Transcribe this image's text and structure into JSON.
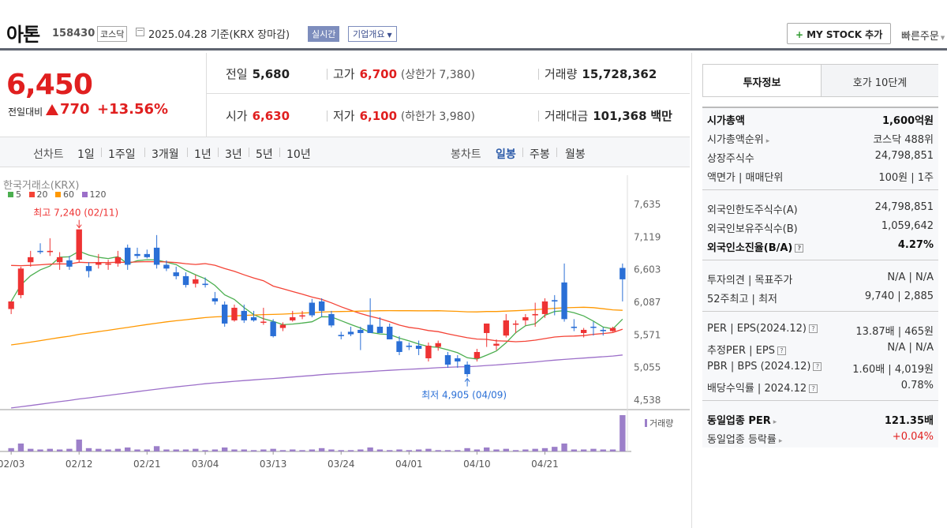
{
  "header": {
    "name": "아톤",
    "code": "158430",
    "market": "코스닥",
    "date": "2025.04.28  기준(KRX 장마감)",
    "realtime": "실시간",
    "overview": "기업개요",
    "my_stock": "MY STOCK 추가",
    "quick_order": "빠른주문"
  },
  "price": {
    "current": "6,450",
    "change_label": "전일대비",
    "change": "770",
    "change_pct": "+13.56%"
  },
  "stats": {
    "prev_label": "전일",
    "prev": "5,680",
    "high_label": "고가",
    "high": "6,700",
    "upper_limit": "(상한가 7,380)",
    "volume_label": "거래량",
    "volume": "15,728,362",
    "open_label": "시가",
    "open": "6,630",
    "low_label": "저가",
    "low": "6,100",
    "lower_limit": "(하한가 3,980)",
    "amount_label": "거래대금",
    "amount": "101,368",
    "amount_unit": "백만"
  },
  "toolbar": {
    "line_label": "선차트",
    "periods": [
      "1일",
      "1주일",
      "3개월",
      "1년",
      "3년",
      "5년",
      "10년"
    ],
    "candle_label": "봉차트",
    "candle_options": [
      "일봉",
      "주봉",
      "월봉"
    ]
  },
  "chart": {
    "source": "한국거래소(KRX)",
    "legend": [
      {
        "label": "5",
        "color": "#4caf50"
      },
      {
        "label": "20",
        "color": "#f44336"
      },
      {
        "label": "60",
        "color": "#ff9800"
      },
      {
        "label": "120",
        "color": "#9c6fc9"
      }
    ],
    "high_note": "최고 7,240 (02/11)",
    "low_note": "최저 4,905 (04/09)",
    "volume_label": "거래량"
  },
  "chart_data": {
    "type": "candlestick",
    "y_ticks": [
      "7,635",
      "7,119",
      "6,603",
      "6,087",
      "5,571",
      "5,055",
      "4,538"
    ],
    "ylim": [
      4538,
      7635
    ],
    "x_labels": [
      "02/03",
      "02/12",
      "02/21",
      "03/04",
      "03/13",
      "03/24",
      "04/01",
      "04/10",
      "04/21"
    ],
    "x_label_index": [
      0,
      7,
      14,
      20,
      27,
      34,
      41,
      48,
      55
    ],
    "candles": [
      {
        "o": 5980,
        "h": 6080,
        "l": 5900,
        "c": 6100
      },
      {
        "o": 6200,
        "h": 6650,
        "l": 6150,
        "c": 6620
      },
      {
        "o": 6720,
        "h": 6900,
        "l": 6650,
        "c": 6800
      },
      {
        "o": 6900,
        "h": 7020,
        "l": 6850,
        "c": 6880
      },
      {
        "o": 6880,
        "h": 7100,
        "l": 6820,
        "c": 6900
      },
      {
        "o": 6720,
        "h": 6880,
        "l": 6600,
        "c": 6800
      },
      {
        "o": 6750,
        "h": 6820,
        "l": 6600,
        "c": 6650
      },
      {
        "o": 6760,
        "h": 7240,
        "l": 6720,
        "c": 7240
      },
      {
        "o": 6660,
        "h": 6720,
        "l": 6480,
        "c": 6580
      },
      {
        "o": 6680,
        "h": 6850,
        "l": 6620,
        "c": 6720
      },
      {
        "o": 6700,
        "h": 6760,
        "l": 6600,
        "c": 6700
      },
      {
        "o": 6700,
        "h": 6900,
        "l": 6650,
        "c": 6800
      },
      {
        "o": 6950,
        "h": 7000,
        "l": 6600,
        "c": 6680
      },
      {
        "o": 6850,
        "h": 6950,
        "l": 6780,
        "c": 6820
      },
      {
        "o": 6850,
        "h": 6920,
        "l": 6780,
        "c": 6800
      },
      {
        "o": 6950,
        "h": 7150,
        "l": 6620,
        "c": 6680
      },
      {
        "o": 6680,
        "h": 6750,
        "l": 6580,
        "c": 6620
      },
      {
        "o": 6560,
        "h": 6650,
        "l": 6450,
        "c": 6500
      },
      {
        "o": 6500,
        "h": 6560,
        "l": 6320,
        "c": 6360
      },
      {
        "o": 6380,
        "h": 6520,
        "l": 6320,
        "c": 6450
      },
      {
        "o": 6380,
        "h": 6480,
        "l": 6320,
        "c": 6360
      },
      {
        "o": 6150,
        "h": 6250,
        "l": 6050,
        "c": 6100
      },
      {
        "o": 6050,
        "h": 6100,
        "l": 5700,
        "c": 5750
      },
      {
        "o": 5800,
        "h": 6050,
        "l": 5780,
        "c": 6000
      },
      {
        "o": 5950,
        "h": 6050,
        "l": 5760,
        "c": 5800
      },
      {
        "o": 5850,
        "h": 5950,
        "l": 5780,
        "c": 5800
      },
      {
        "o": 5780,
        "h": 6000,
        "l": 5730,
        "c": 5780
      },
      {
        "o": 5780,
        "h": 5820,
        "l": 5530,
        "c": 5550
      },
      {
        "o": 5680,
        "h": 5770,
        "l": 5630,
        "c": 5730
      },
      {
        "o": 5800,
        "h": 5950,
        "l": 5780,
        "c": 5850
      },
      {
        "o": 5880,
        "h": 5950,
        "l": 5820,
        "c": 5880
      },
      {
        "o": 6080,
        "h": 6140,
        "l": 5850,
        "c": 5880
      },
      {
        "o": 6100,
        "h": 6150,
        "l": 5850,
        "c": 5950
      },
      {
        "o": 5900,
        "h": 5950,
        "l": 5690,
        "c": 5720
      },
      {
        "o": 5570,
        "h": 5620,
        "l": 5500,
        "c": 5550
      },
      {
        "o": 5620,
        "h": 5700,
        "l": 5550,
        "c": 5580
      },
      {
        "o": 5650,
        "h": 5700,
        "l": 5330,
        "c": 5600
      },
      {
        "o": 5730,
        "h": 6150,
        "l": 5700,
        "c": 5600
      },
      {
        "o": 5700,
        "h": 5850,
        "l": 5650,
        "c": 5600
      },
      {
        "o": 5700,
        "h": 5750,
        "l": 5500,
        "c": 5500
      },
      {
        "o": 5470,
        "h": 5550,
        "l": 5250,
        "c": 5300
      },
      {
        "o": 5400,
        "h": 5450,
        "l": 5330,
        "c": 5380
      },
      {
        "o": 5400,
        "h": 5480,
        "l": 5250,
        "c": 5350
      },
      {
        "o": 5200,
        "h": 5450,
        "l": 5150,
        "c": 5400
      },
      {
        "o": 5380,
        "h": 5480,
        "l": 5320,
        "c": 5440
      },
      {
        "o": 5250,
        "h": 5300,
        "l": 5050,
        "c": 5100
      },
      {
        "o": 5200,
        "h": 5250,
        "l": 5050,
        "c": 5150
      },
      {
        "o": 5100,
        "h": 5150,
        "l": 4905,
        "c": 4950
      },
      {
        "o": 5200,
        "h": 5350,
        "l": 5150,
        "c": 5300
      },
      {
        "o": 5600,
        "h": 5750,
        "l": 5380,
        "c": 5750
      },
      {
        "o": 5400,
        "h": 5500,
        "l": 5330,
        "c": 5430
      },
      {
        "o": 5560,
        "h": 5900,
        "l": 5530,
        "c": 5800
      },
      {
        "o": 5750,
        "h": 5800,
        "l": 5600,
        "c": 5750
      },
      {
        "o": 5800,
        "h": 5900,
        "l": 5720,
        "c": 5850
      },
      {
        "o": 5880,
        "h": 6080,
        "l": 5700,
        "c": 5900
      },
      {
        "o": 5900,
        "h": 6150,
        "l": 5840,
        "c": 6100
      },
      {
        "o": 6120,
        "h": 6200,
        "l": 5880,
        "c": 6100
      },
      {
        "o": 6400,
        "h": 6700,
        "l": 5780,
        "c": 5820
      },
      {
        "o": 5700,
        "h": 5820,
        "l": 5630,
        "c": 5680
      },
      {
        "o": 5600,
        "h": 5680,
        "l": 5530,
        "c": 5650
      },
      {
        "o": 5700,
        "h": 5780,
        "l": 5560,
        "c": 5690
      },
      {
        "o": 5650,
        "h": 5690,
        "l": 5560,
        "c": 5630
      },
      {
        "o": 5630,
        "h": 5700,
        "l": 5620,
        "c": 5680
      },
      {
        "o": 6630,
        "h": 6700,
        "l": 6100,
        "c": 6450
      }
    ],
    "volume": [
      5,
      12,
      4,
      3,
      4,
      3,
      4,
      18,
      5,
      4,
      3,
      4,
      6,
      3,
      3,
      8,
      3,
      3,
      3,
      4,
      2,
      3,
      6,
      3,
      3,
      2,
      3,
      4,
      2,
      3,
      2,
      3,
      5,
      3,
      2,
      2,
      3,
      6,
      3,
      2,
      3,
      2,
      3,
      4,
      2,
      2,
      2,
      5,
      3,
      6,
      3,
      4,
      2,
      3,
      4,
      5,
      7,
      12,
      3,
      3,
      4,
      3,
      3,
      55
    ]
  },
  "right_panel": {
    "tab_invest": "투자정보",
    "tab_hoga": "호가 10단계",
    "rows": [
      {
        "l": "시가총액",
        "r": "1,600억원"
      },
      {
        "l": "시가총액순위",
        "r": "코스닥 488위"
      },
      {
        "l": "상장주식수",
        "r": "24,798,851"
      },
      {
        "l": "액면가 | 매매단위",
        "r": "100원 | 1주"
      },
      {
        "l": "외국인한도주식수(A)",
        "r": "24,798,851"
      },
      {
        "l": "외국인보유주식수(B)",
        "r": "1,059,642"
      },
      {
        "l": "외국인소진율(B/A)",
        "r": "4.27%"
      },
      {
        "l": "투자의견 | 목표주가",
        "r": "N/A | N/A"
      },
      {
        "l": "52주최고 | 최저",
        "r": "9,740 | 2,885"
      },
      {
        "l": "PER | EPS(2024.12)",
        "r": "13.87배 | 465원"
      },
      {
        "l": "추정PER | EPS",
        "r": "N/A | N/A"
      },
      {
        "l": "PBR | BPS (2024.12)",
        "r": "1.60배 | 4,019원"
      },
      {
        "l": "배당수익률 | 2024.12",
        "r": "0.78%"
      },
      {
        "l": "동일업종 PER",
        "r": "121.35배"
      },
      {
        "l": "동일업종 등락률",
        "r": "+0.04%"
      }
    ]
  }
}
